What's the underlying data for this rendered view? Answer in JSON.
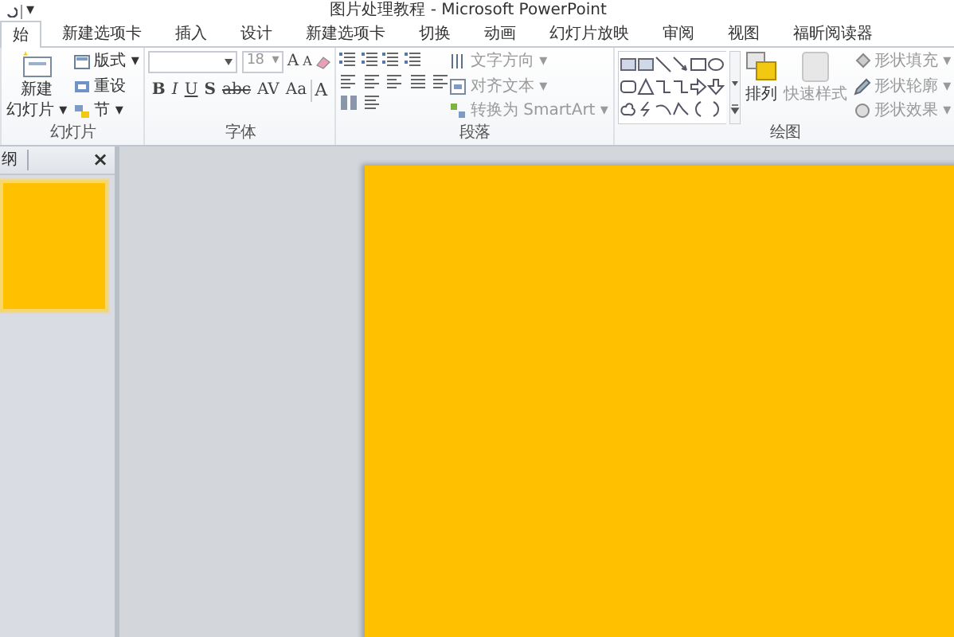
{
  "window": {
    "title": "图片处理教程 - Microsoft PowerPoint",
    "qat_caret": "▾"
  },
  "tabs": [
    {
      "label": "始",
      "selected": true
    },
    {
      "label": "新建选项卡",
      "selected": false
    },
    {
      "label": "插入",
      "selected": false
    },
    {
      "label": "设计",
      "selected": false
    },
    {
      "label": "新建选项卡",
      "selected": false
    },
    {
      "label": "切换",
      "selected": false
    },
    {
      "label": "动画",
      "selected": false
    },
    {
      "label": "幻灯片放映",
      "selected": false
    },
    {
      "label": "审阅",
      "selected": false
    },
    {
      "label": "视图",
      "selected": false
    },
    {
      "label": "福昕阅读器",
      "selected": false
    }
  ],
  "ribbon": {
    "slides_group": {
      "label": "幻灯片",
      "new_slide": [
        "新建",
        "幻灯片 ▾"
      ],
      "buttons": [
        {
          "label": "版式 ▾"
        },
        {
          "label": "重设"
        },
        {
          "label": "节 ▾"
        }
      ]
    },
    "font_group": {
      "label": "字体",
      "font_size": "18",
      "size_caret": "▾",
      "grow": "A",
      "shrink": "A",
      "format_buttons": [
        "B",
        "I",
        "U",
        "S",
        "abc",
        "AV",
        "Aa",
        "A"
      ]
    },
    "paragraph_group": {
      "label": "段落",
      "buttons": [
        {
          "label": "文字方向 ▾"
        },
        {
          "label": "对齐文本 ▾"
        },
        {
          "label": "转换为 SmartArt ▾"
        }
      ]
    },
    "drawing_group": {
      "label": "绘图",
      "arrange": "排列",
      "quick_styles": {
        "label": "快速样式",
        "disabled": true
      },
      "shape_buttons": [
        {
          "label": "形状填充 ▾",
          "disabled": true
        },
        {
          "label": "形状轮廓 ▾",
          "disabled": true
        },
        {
          "label": "形状效果 ▾",
          "disabled": true
        }
      ]
    }
  },
  "slides_pane": {
    "tab": "纲",
    "close": "×",
    "slides": [
      {
        "selected": true
      }
    ]
  }
}
